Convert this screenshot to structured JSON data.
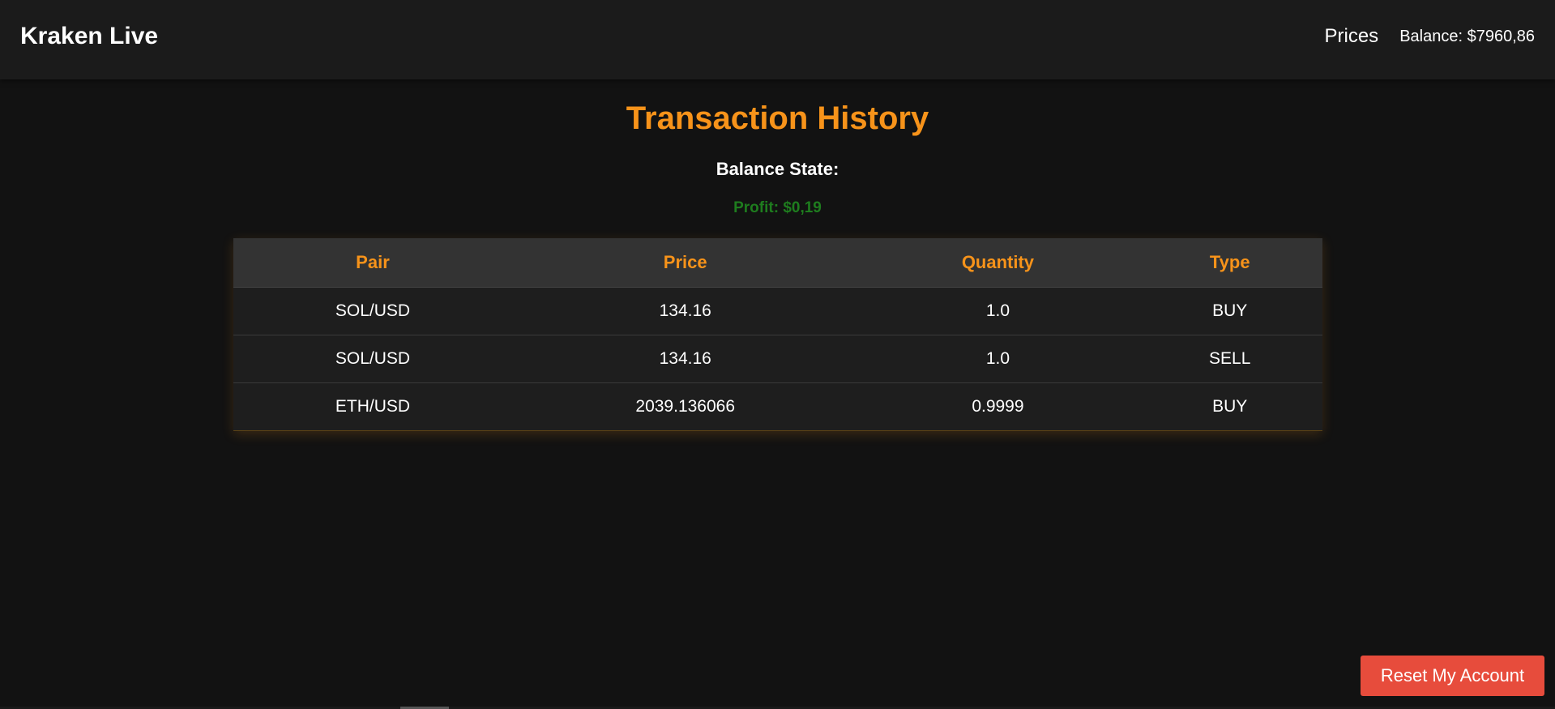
{
  "header": {
    "brand": "Kraken Live",
    "nav_prices": "Prices",
    "balance": "Balance: $7960,86"
  },
  "main": {
    "title": "Transaction History",
    "balance_state_label": "Balance State:",
    "profit": "Profit: $0,19"
  },
  "colors": {
    "accent": "#f7931a",
    "profit": "#1e7d1e",
    "danger": "#e74c3c"
  },
  "table": {
    "headers": [
      "Pair",
      "Price",
      "Quantity",
      "Type"
    ],
    "rows": [
      [
        "SOL/USD",
        "134.16",
        "1.0",
        "BUY"
      ],
      [
        "SOL/USD",
        "134.16",
        "1.0",
        "SELL"
      ],
      [
        "ETH/USD",
        "2039.136066",
        "0.9999",
        "BUY"
      ]
    ]
  },
  "footer": {
    "reset_label": "Reset My Account"
  }
}
